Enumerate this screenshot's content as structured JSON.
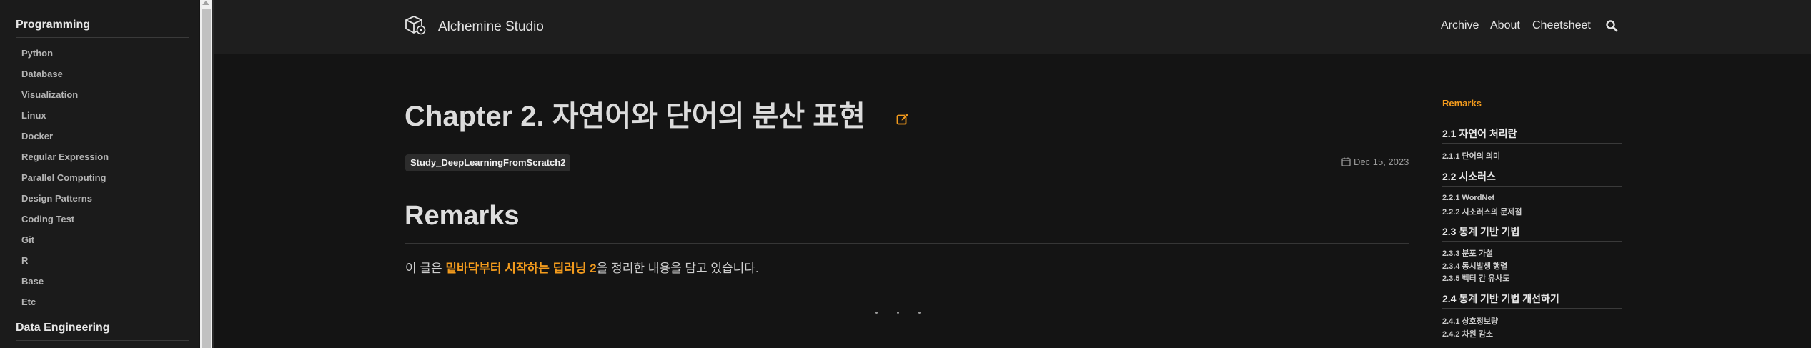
{
  "sidebar": {
    "groups": [
      {
        "title": "Programming",
        "items": [
          "Python",
          "Database",
          "Visualization",
          "Linux",
          "Docker",
          "Regular Expression",
          "Parallel Computing",
          "Design Patterns",
          "Coding Test",
          "Git",
          "R",
          "Base",
          "Etc"
        ]
      },
      {
        "title": "Data Engineering",
        "items": []
      }
    ]
  },
  "header": {
    "brand": "Alchemine Studio",
    "nav": [
      "Archive",
      "About",
      "Cheetsheet"
    ],
    "icons": {
      "logo": "cube-icon",
      "search": "search-icon"
    }
  },
  "post": {
    "title": "Chapter 2. 자연어와 단어의 분산 표현",
    "tag": "Study_DeepLearningFromScratch2",
    "date": "Dec 15, 2023",
    "heading": "Remarks",
    "intro_prefix": "이 글은 ",
    "intro_link": "밑바닥부터 시작하는 딥러닝 2",
    "intro_suffix": "을 정리한 내용을 담고 있습니다."
  },
  "toc": {
    "title": "Remarks",
    "sections": [
      {
        "label": "2.1 자연어 처리란",
        "subs": [
          "2.1.1 단어의 의미"
        ]
      },
      {
        "label": "2.2 시소러스",
        "subs": [
          "2.2.1 WordNet",
          "2.2.2 시소러스의 문제점"
        ]
      },
      {
        "label": "2.3 통계 기반 기법",
        "subs": [
          "2.3.3 분포 가설",
          "2.3.4 동시발생 행렬",
          "2.3.5 벡터 간 유사도"
        ]
      },
      {
        "label": "2.4 통계 기반 기법 개선하기",
        "subs": [
          "2.4.1 상호정보량",
          "2.4.2 차원 감소"
        ]
      }
    ]
  },
  "colors": {
    "accent": "#f39b1d",
    "background": "#141414",
    "sidebar": "#1b1b1b",
    "header": "#1e1e1e"
  }
}
